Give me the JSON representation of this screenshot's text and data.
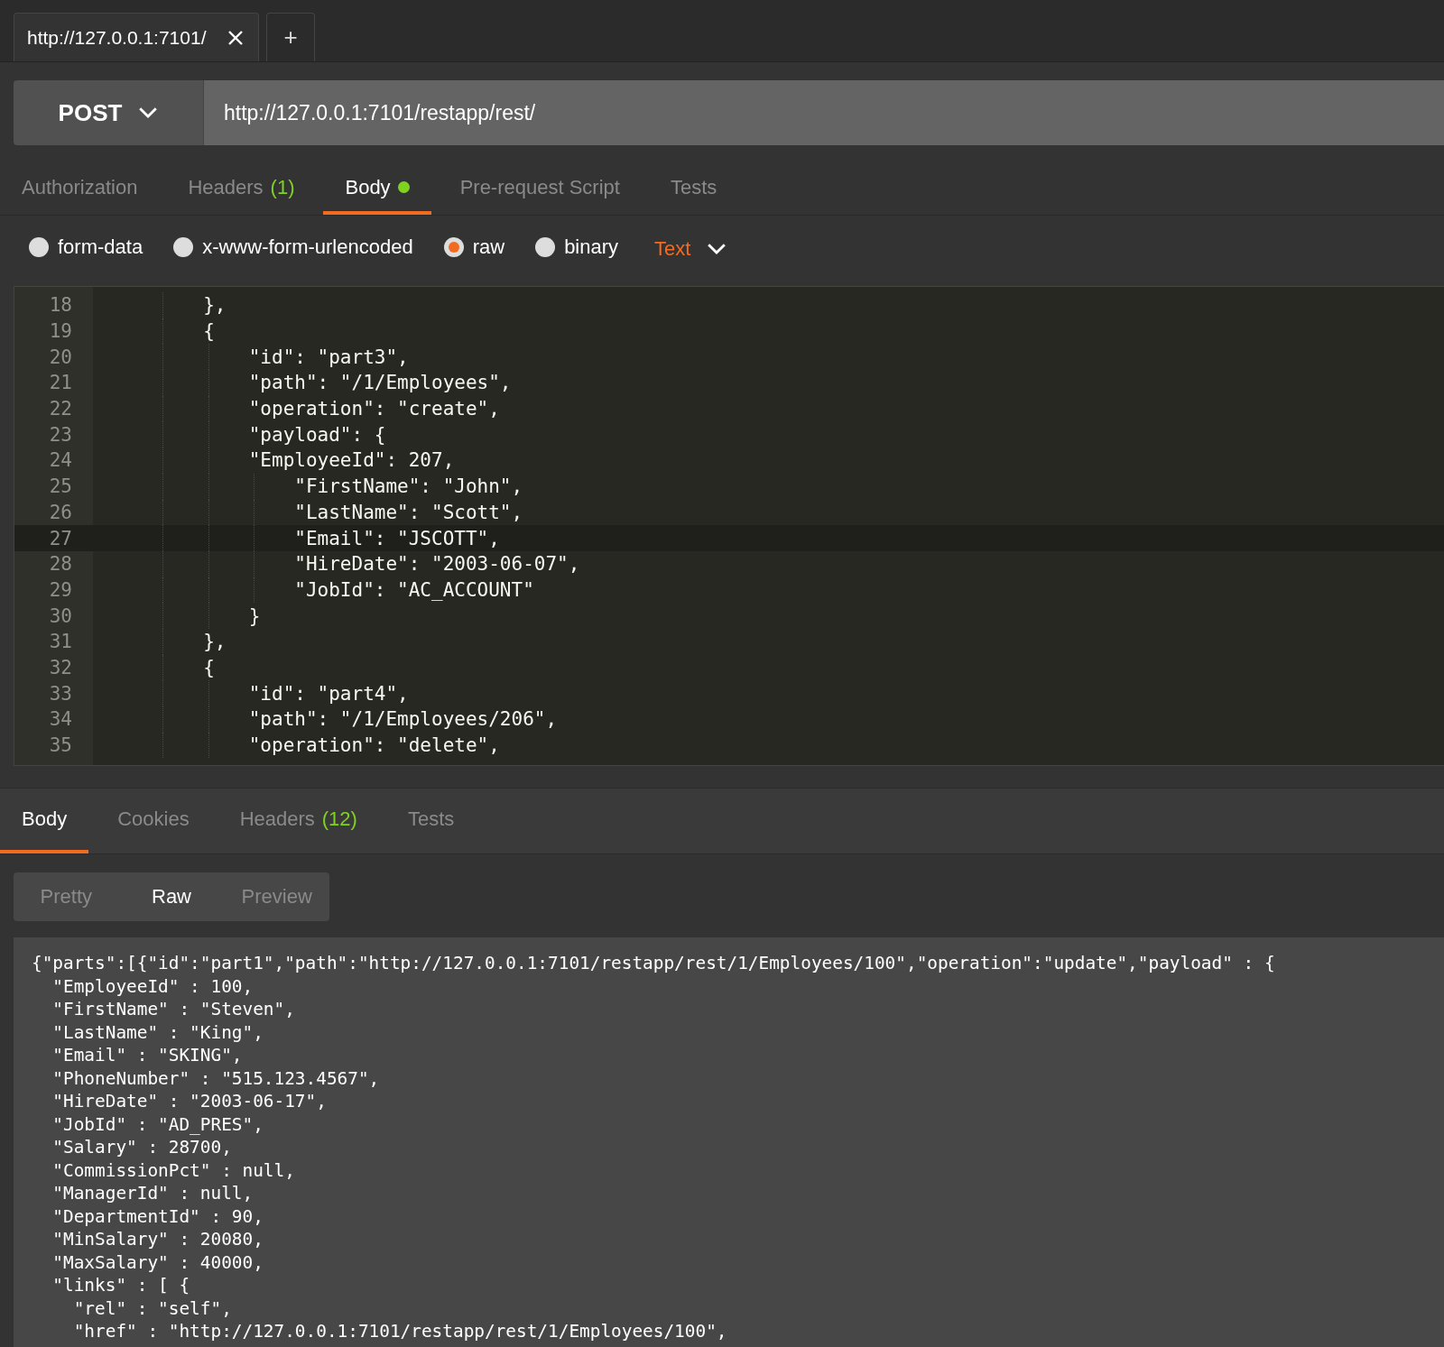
{
  "request_tabs": [
    {
      "label": "http://127.0.0.1:7101/"
    }
  ],
  "new_tab": "+",
  "request": {
    "method": "POST",
    "url": "http://127.0.0.1:7101/restapp/rest/"
  },
  "request_sections": [
    {
      "label": "Authorization",
      "selected": false
    },
    {
      "label": "Headers",
      "count": "(1)",
      "selected": false
    },
    {
      "label": "Body",
      "selected": true,
      "dot": true
    },
    {
      "label": "Pre-request Script",
      "selected": false
    },
    {
      "label": "Tests",
      "selected": false
    }
  ],
  "body_modes": [
    {
      "label": "form-data",
      "selected": false
    },
    {
      "label": "x-www-form-urlencoded",
      "selected": false
    },
    {
      "label": "raw",
      "selected": true
    },
    {
      "label": "binary",
      "selected": false
    }
  ],
  "content_type": "Text",
  "editor": {
    "lines": [
      {
        "number": "18",
        "text": "        },",
        "current": false
      },
      {
        "number": "19",
        "text": "        {",
        "current": false
      },
      {
        "number": "20",
        "text": "            \"id\": \"part3\",",
        "current": false
      },
      {
        "number": "21",
        "text": "            \"path\": \"/1/Employees\",",
        "current": false
      },
      {
        "number": "22",
        "text": "            \"operation\": \"create\",",
        "current": false
      },
      {
        "number": "23",
        "text": "            \"payload\": {",
        "current": false
      },
      {
        "number": "24",
        "text": "            \"EmployeeId\": 207,",
        "current": false
      },
      {
        "number": "25",
        "text": "                \"FirstName\": \"John\",",
        "current": false
      },
      {
        "number": "26",
        "text": "                \"LastName\": \"Scott\",",
        "current": false
      },
      {
        "number": "27",
        "text": "                \"Email\": \"JSCOTT\",",
        "current": true
      },
      {
        "number": "28",
        "text": "                \"HireDate\": \"2003-06-07\",",
        "current": false
      },
      {
        "number": "29",
        "text": "                \"JobId\": \"AC_ACCOUNT\"",
        "current": false
      },
      {
        "number": "30",
        "text": "            }",
        "current": false
      },
      {
        "number": "31",
        "text": "        },",
        "current": false
      },
      {
        "number": "32",
        "text": "        {",
        "current": false
      },
      {
        "number": "33",
        "text": "            \"id\": \"part4\",",
        "current": false
      },
      {
        "number": "34",
        "text": "            \"path\": \"/1/Employees/206\",",
        "current": false
      },
      {
        "number": "35",
        "text": "            \"operation\": \"delete\",",
        "current": false
      }
    ]
  },
  "response_tabs": [
    {
      "label": "Body",
      "selected": true
    },
    {
      "label": "Cookies",
      "selected": false
    },
    {
      "label": "Headers",
      "count": "(12)",
      "selected": false
    },
    {
      "label": "Tests",
      "selected": false
    }
  ],
  "view_modes": [
    {
      "label": "Pretty",
      "selected": false
    },
    {
      "label": "Raw",
      "selected": true
    },
    {
      "label": "Preview",
      "selected": false
    }
  ],
  "response_lines": [
    "{\"parts\":[{\"id\":\"part1\",\"path\":\"http://127.0.0.1:7101/restapp/rest/1/Employees/100\",\"operation\":\"update\",\"payload\" : {",
    "  \"EmployeeId\" : 100,",
    "  \"FirstName\" : \"Steven\",",
    "  \"LastName\" : \"King\",",
    "  \"Email\" : \"SKING\",",
    "  \"PhoneNumber\" : \"515.123.4567\",",
    "  \"HireDate\" : \"2003-06-17\",",
    "  \"JobId\" : \"AD_PRES\",",
    "  \"Salary\" : 28700,",
    "  \"CommissionPct\" : null,",
    "  \"ManagerId\" : null,",
    "  \"DepartmentId\" : 90,",
    "  \"MinSalary\" : 20080,",
    "  \"MaxSalary\" : 40000,",
    "  \"links\" : [ {",
    "    \"rel\" : \"self\",",
    "    \"href\" : \"http://127.0.0.1:7101/restapp/rest/1/Employees/100\","
  ]
}
